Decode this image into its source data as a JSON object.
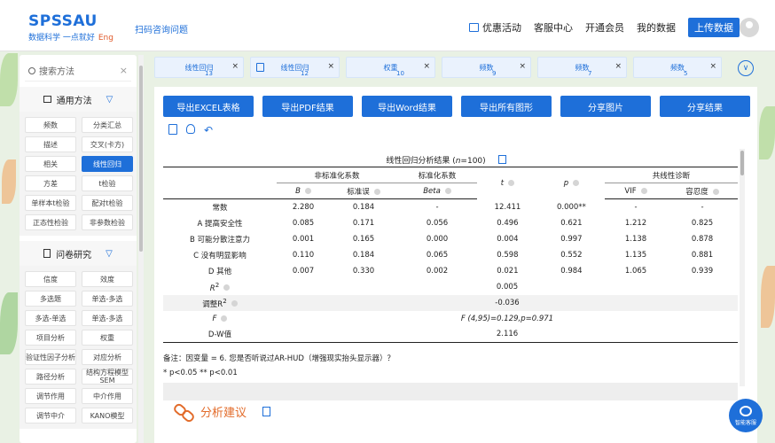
{
  "header": {
    "logo_main": "SPSSAU",
    "logo_sub": "数据科学 一点就好",
    "logo_eng": "Eng",
    "scan_text": "扫码咨询问题",
    "nav": [
      {
        "label": "优惠活动",
        "icon": "gift-icon"
      },
      {
        "label": "客服中心"
      },
      {
        "label": "开通会员"
      },
      {
        "label": "我的数据"
      },
      {
        "label": "上传数据"
      }
    ]
  },
  "sidebar": {
    "search_placeholder": "搜索方法",
    "section1_title": "通用方法",
    "section1_items": [
      "频数",
      "分类汇总",
      "描述",
      "交叉(卡方)",
      "相关",
      "线性回归",
      "方差",
      "t检验",
      "单样本t检验",
      "配对t检验",
      "正态性检验",
      "非参数检验"
    ],
    "section1_active": "线性回归",
    "section2_title": "问卷研究",
    "section2_items": [
      "信度",
      "效度",
      "多选题",
      "单选-多选",
      "多选-单选",
      "单选-多选",
      "项目分析",
      "权重",
      "验证性因子分析",
      "对应分析",
      "路径分析",
      "结构方程模型SEM",
      "调节作用",
      "中介作用",
      "调节中介",
      "KANO模型"
    ]
  },
  "tabs": [
    {
      "label": "线性回归",
      "num": "13",
      "active": false
    },
    {
      "label": "线性回归",
      "num": "12",
      "active": true
    },
    {
      "label": "权重",
      "num": "10",
      "active": false
    },
    {
      "label": "频数",
      "num": "9",
      "active": false
    },
    {
      "label": "频数",
      "num": "7",
      "active": false
    },
    {
      "label": "频数",
      "num": "5",
      "active": false
    }
  ],
  "buttons": [
    "导出EXCEL表格",
    "导出PDF结果",
    "导出Word结果",
    "导出所有图形",
    "分享图片",
    "分享结果"
  ],
  "table": {
    "title_prefix": "线性回归分析结果 (",
    "title_n": "n",
    "title_suffix": "=100)",
    "h_unstd": "非标准化系数",
    "h_std": "标准化系数",
    "h_t": "t",
    "h_p": "p",
    "h_col": "共线性诊断",
    "h_B": "B",
    "h_se": "标准误",
    "h_beta": "Beta",
    "h_vif": "VIF",
    "h_tol": "容忍度",
    "rows": [
      {
        "name": "常数",
        "B": "2.280",
        "se": "0.184",
        "beta": "-",
        "t": "12.411",
        "p": "0.000**",
        "vif": "-",
        "tol": "-"
      },
      {
        "name": "A 提高安全性",
        "B": "0.085",
        "se": "0.171",
        "beta": "0.056",
        "t": "0.496",
        "p": "0.621",
        "vif": "1.212",
        "tol": "0.825"
      },
      {
        "name": "B 可能分散注意力",
        "B": "0.001",
        "se": "0.165",
        "beta": "0.000",
        "t": "0.004",
        "p": "0.997",
        "vif": "1.138",
        "tol": "0.878"
      },
      {
        "name": "C 没有明显影响",
        "B": "0.110",
        "se": "0.184",
        "beta": "0.065",
        "t": "0.598",
        "p": "0.552",
        "vif": "1.135",
        "tol": "0.881"
      },
      {
        "name": "D 其他",
        "B": "0.007",
        "se": "0.330",
        "beta": "0.002",
        "t": "0.021",
        "p": "0.984",
        "vif": "1.065",
        "tol": "0.939"
      }
    ],
    "r2_label": "R",
    "r2_sup": "2",
    "r2_value": "0.005",
    "adjr2_label": "调整R",
    "adjr2_sup": "2",
    "adjr2_value": "-0.036",
    "f_label": "F",
    "f_value": "F (4,95)=0.129,p=0.971",
    "dw_label": "D-W值",
    "dw_value": "2.116",
    "note1": "备注：因变量 = 6. 您是否听说过AR-HUD（增强现实抬头显示器）？",
    "note2": "* p<0.05 ** p<0.01"
  },
  "analysis_title": "分析建议",
  "chat_label": "智能客服"
}
